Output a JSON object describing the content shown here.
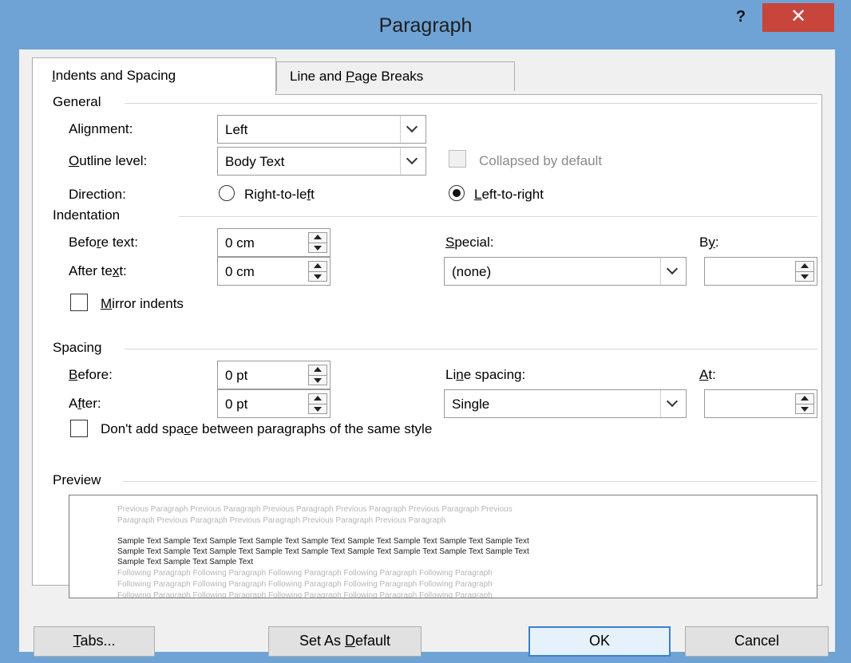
{
  "window": {
    "title": "Paragraph",
    "help_glyph": "?",
    "close_glyph": "✕"
  },
  "tabs": {
    "indents": {
      "pre": "",
      "mnemonic": "I",
      "post": "ndents and Spacing"
    },
    "breaks": {
      "pre": "Line and ",
      "mnemonic": "P",
      "post": "age Breaks"
    }
  },
  "general": {
    "header": "General",
    "alignment": {
      "pre": "Ali",
      "mnemonic": "g",
      "post": "nment:",
      "value": "Left"
    },
    "outline": {
      "pre": "",
      "mnemonic": "O",
      "post": "utline level:",
      "value": "Body Text"
    },
    "collapsed": {
      "label": "Collapsed by default",
      "checked": false,
      "disabled": true
    },
    "direction": {
      "label": "Direction:",
      "rtl": {
        "pre": "Right-to-le",
        "mnemonic": "f",
        "post": "t",
        "selected": false
      },
      "ltr": {
        "pre": "",
        "mnemonic": "L",
        "post": "eft-to-right",
        "selected": true
      }
    }
  },
  "indentation": {
    "header": "Indentation",
    "before": {
      "pre": "Befo",
      "mnemonic": "r",
      "post": "e text:",
      "value": "0 cm"
    },
    "after": {
      "pre": "After te",
      "mnemonic": "x",
      "post": "t:",
      "value": "0 cm"
    },
    "special": {
      "pre": "",
      "mnemonic": "S",
      "post": "pecial:",
      "value": "(none)"
    },
    "by": {
      "pre": "B",
      "mnemonic": "y",
      "post": ":",
      "value": ""
    },
    "mirror": {
      "pre": "",
      "mnemonic": "M",
      "post": "irror indents",
      "checked": false
    }
  },
  "spacing": {
    "header": "Spacing",
    "before": {
      "pre": "",
      "mnemonic": "B",
      "post": "efore:",
      "value": "0 pt"
    },
    "after": {
      "pre": "A",
      "mnemonic": "f",
      "post": "ter:",
      "value": "0 pt"
    },
    "line": {
      "pre": "Li",
      "mnemonic": "n",
      "post": "e spacing:",
      "value": "Single"
    },
    "at": {
      "pre": "",
      "mnemonic": "A",
      "post": "t:",
      "value": ""
    },
    "dont_add": {
      "pre": "Don't add spa",
      "mnemonic": "c",
      "post": "e between paragraphs of the same style",
      "checked": false
    }
  },
  "preview": {
    "header": "Preview",
    "previous": [
      "Previous Paragraph Previous Paragraph Previous Paragraph Previous Paragraph Previous Paragraph Previous",
      "Paragraph Previous Paragraph Previous Paragraph Previous Paragraph Previous Paragraph"
    ],
    "sample": [
      "Sample Text Sample Text Sample Text Sample Text Sample Text Sample Text Sample Text Sample Text Sample Text",
      "Sample Text Sample Text Sample Text Sample Text Sample Text Sample Text Sample Text Sample Text Sample Text",
      "Sample Text Sample Text Sample Text"
    ],
    "following": [
      "Following Paragraph Following Paragraph Following Paragraph Following Paragraph Following Paragraph",
      "Following Paragraph Following Paragraph Following Paragraph Following Paragraph Following Paragraph",
      "Following Paragraph Following Paragraph Following Paragraph Following Paragraph Following Paragraph"
    ]
  },
  "buttons": {
    "tabs": {
      "pre": "",
      "mnemonic": "T",
      "post": "abs..."
    },
    "set_default": {
      "pre": "Set As ",
      "mnemonic": "D",
      "post": "efault"
    },
    "ok": {
      "pre": "OK",
      "mnemonic": "",
      "post": ""
    },
    "cancel": {
      "pre": "Cancel",
      "mnemonic": "",
      "post": ""
    }
  },
  "colors": {
    "titlebar": "#6fa3d6",
    "close": "#c8453c",
    "default_button_border": "#3c7fd1"
  }
}
